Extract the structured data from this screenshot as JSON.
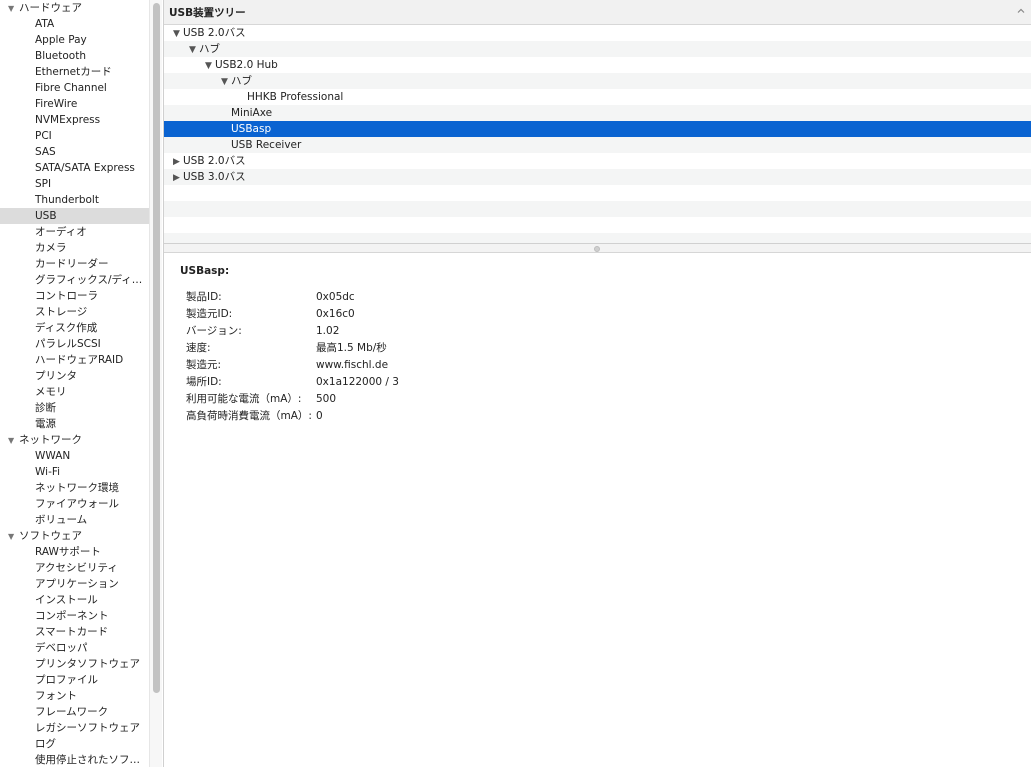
{
  "sidebar": {
    "items": [
      {
        "label": "ハードウェア",
        "type": "category"
      },
      {
        "label": "ATA",
        "type": "item"
      },
      {
        "label": "Apple Pay",
        "type": "item"
      },
      {
        "label": "Bluetooth",
        "type": "item"
      },
      {
        "label": "Ethernetカード",
        "type": "item"
      },
      {
        "label": "Fibre Channel",
        "type": "item"
      },
      {
        "label": "FireWire",
        "type": "item"
      },
      {
        "label": "NVMExpress",
        "type": "item"
      },
      {
        "label": "PCI",
        "type": "item"
      },
      {
        "label": "SAS",
        "type": "item"
      },
      {
        "label": "SATA/SATA Express",
        "type": "item"
      },
      {
        "label": "SPI",
        "type": "item"
      },
      {
        "label": "Thunderbolt",
        "type": "item"
      },
      {
        "label": "USB",
        "type": "item",
        "selected": true
      },
      {
        "label": "オーディオ",
        "type": "item"
      },
      {
        "label": "カメラ",
        "type": "item"
      },
      {
        "label": "カードリーダー",
        "type": "item"
      },
      {
        "label": "グラフィックス/ディ…",
        "type": "item"
      },
      {
        "label": "コントローラ",
        "type": "item"
      },
      {
        "label": "ストレージ",
        "type": "item"
      },
      {
        "label": "ディスク作成",
        "type": "item"
      },
      {
        "label": "パラレルSCSI",
        "type": "item"
      },
      {
        "label": "ハードウェアRAID",
        "type": "item"
      },
      {
        "label": "プリンタ",
        "type": "item"
      },
      {
        "label": "メモリ",
        "type": "item"
      },
      {
        "label": "診断",
        "type": "item"
      },
      {
        "label": "電源",
        "type": "item"
      },
      {
        "label": "ネットワーク",
        "type": "category"
      },
      {
        "label": "WWAN",
        "type": "item"
      },
      {
        "label": "Wi-Fi",
        "type": "item"
      },
      {
        "label": "ネットワーク環境",
        "type": "item"
      },
      {
        "label": "ファイアウォール",
        "type": "item"
      },
      {
        "label": "ボリューム",
        "type": "item"
      },
      {
        "label": "ソフトウェア",
        "type": "category"
      },
      {
        "label": "RAWサポート",
        "type": "item"
      },
      {
        "label": "アクセシビリティ",
        "type": "item"
      },
      {
        "label": "アプリケーション",
        "type": "item"
      },
      {
        "label": "インストール",
        "type": "item"
      },
      {
        "label": "コンポーネント",
        "type": "item"
      },
      {
        "label": "スマートカード",
        "type": "item"
      },
      {
        "label": "デベロッパ",
        "type": "item"
      },
      {
        "label": "プリンタソフトウェア",
        "type": "item"
      },
      {
        "label": "プロファイル",
        "type": "item"
      },
      {
        "label": "フォント",
        "type": "item"
      },
      {
        "label": "フレームワーク",
        "type": "item"
      },
      {
        "label": "レガシーソフトウェア",
        "type": "item"
      },
      {
        "label": "ログ",
        "type": "item"
      },
      {
        "label": "使用停止されたソフ…",
        "type": "item"
      }
    ]
  },
  "header": {
    "title": "USB装置ツリー"
  },
  "tree": {
    "rows": [
      {
        "label": "USB 2.0バス",
        "level": 0,
        "expander": "expanded"
      },
      {
        "label": "ハブ",
        "level": 1,
        "expander": "expanded"
      },
      {
        "label": "USB2.0 Hub",
        "level": 2,
        "expander": "expanded"
      },
      {
        "label": "ハブ",
        "level": 3,
        "expander": "expanded"
      },
      {
        "label": "HHKB Professional",
        "level": 4,
        "expander": "none"
      },
      {
        "label": "MiniAxe",
        "level": 3,
        "expander": "none"
      },
      {
        "label": "USBasp",
        "level": 3,
        "expander": "none",
        "selected": true
      },
      {
        "label": "USB Receiver",
        "level": 3,
        "expander": "none"
      },
      {
        "label": "USB 2.0バス",
        "level": 0,
        "expander": "collapsed"
      },
      {
        "label": "USB 3.0バス",
        "level": 0,
        "expander": "collapsed"
      }
    ],
    "empty_rows": 4
  },
  "detail": {
    "title": "USBasp:",
    "fields": [
      {
        "key": "製品ID:",
        "value": "0x05dc"
      },
      {
        "key": "製造元ID:",
        "value": "0x16c0"
      },
      {
        "key": "バージョン:",
        "value": "1.02"
      },
      {
        "key": "速度:",
        "value": "最高1.5 Mb/秒"
      },
      {
        "key": "製造元:",
        "value": "www.fischl.de"
      },
      {
        "key": "場所ID:",
        "value": "0x1a122000 / 3"
      },
      {
        "key": "利用可能な電流（mA）:",
        "value": "500"
      },
      {
        "key": "高負荷時消費電流（mA）:",
        "value": "0"
      }
    ]
  },
  "colors": {
    "selection": "#0a63d1",
    "sidebar_selection": "#dcdcdc",
    "alt_row": "#f4f5f5"
  }
}
